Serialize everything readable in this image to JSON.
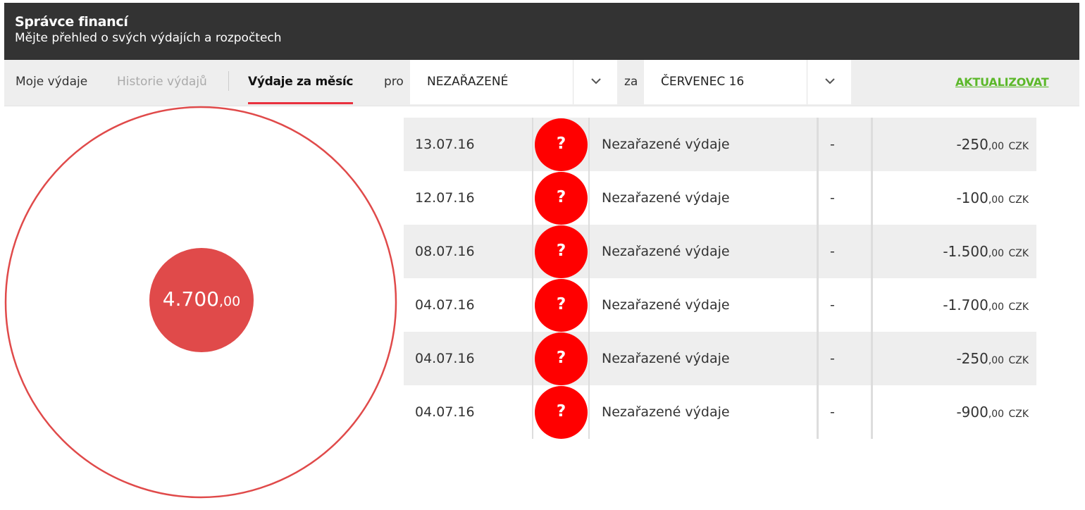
{
  "header": {
    "title": "Správce financí",
    "subtitle": "Mějte přehled o svých výdajích a rozpočtech"
  },
  "toolbar": {
    "tabs": [
      {
        "label": "Moje výdaje",
        "state": "normal"
      },
      {
        "label": "Historie výdajů",
        "state": "disabled"
      },
      {
        "label": "Výdaje za měsíc",
        "state": "active"
      }
    ],
    "for_label": "pro",
    "category_select": {
      "value": "NEZAŘAZENÉ"
    },
    "period_label": "za",
    "month_select": {
      "value": "ČERVENEC 16"
    },
    "refresh_label": "AKTUALIZOVAT"
  },
  "chart": {
    "total_whole": "4.700",
    "total_decimals": ",00",
    "accent_color": "#e04a4a"
  },
  "expenses": [
    {
      "date": "13.07.16",
      "icon": "?",
      "category": "Nezařazené výdaje",
      "note": "-",
      "amount_whole": "-250",
      "amount_decimals": ",00",
      "currency": "CZK"
    },
    {
      "date": "12.07.16",
      "icon": "?",
      "category": "Nezařazené výdaje",
      "note": "-",
      "amount_whole": "-100",
      "amount_decimals": ",00",
      "currency": "CZK"
    },
    {
      "date": "08.07.16",
      "icon": "?",
      "category": "Nezařazené výdaje",
      "note": "-",
      "amount_whole": "-1.500",
      "amount_decimals": ",00",
      "currency": "CZK"
    },
    {
      "date": "04.07.16",
      "icon": "?",
      "category": "Nezařazené výdaje",
      "note": "-",
      "amount_whole": "-1.700",
      "amount_decimals": ",00",
      "currency": "CZK"
    },
    {
      "date": "04.07.16",
      "icon": "?",
      "category": "Nezařazené výdaje",
      "note": "-",
      "amount_whole": "-250",
      "amount_decimals": ",00",
      "currency": "CZK"
    },
    {
      "date": "04.07.16",
      "icon": "?",
      "category": "Nezařazené výdaje",
      "note": "-",
      "amount_whole": "-900",
      "amount_decimals": ",00",
      "currency": "CZK"
    }
  ]
}
